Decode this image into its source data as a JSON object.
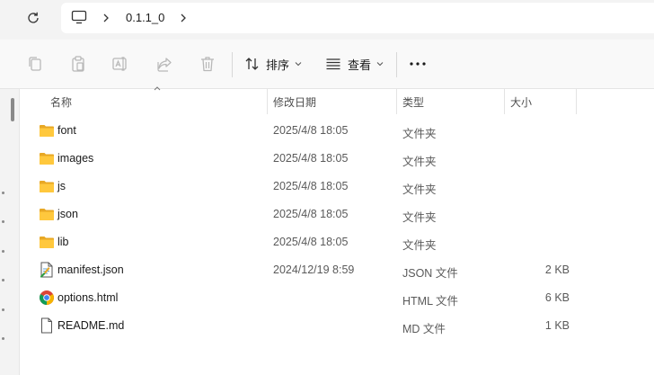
{
  "address_bar": {
    "root_icon": "computer-icon",
    "path_segments": [
      "0.1.1_0"
    ]
  },
  "toolbar": {
    "actions": [
      {
        "name": "copy",
        "icon": "copy-icon"
      },
      {
        "name": "paste",
        "icon": "paste-icon"
      },
      {
        "name": "rename",
        "icon": "rename-icon"
      },
      {
        "name": "share",
        "icon": "share-icon"
      },
      {
        "name": "delete",
        "icon": "trash-icon"
      }
    ],
    "sort_label": "排序",
    "view_label": "查看",
    "more_icon": "more-icon"
  },
  "columns": {
    "name": "名称",
    "date_modified": "修改日期",
    "type": "类型",
    "size": "大小"
  },
  "files": [
    {
      "name": "font",
      "date": "2025/4/8 18:05",
      "type": "文件夹",
      "size": "",
      "icon": "folder-icon"
    },
    {
      "name": "images",
      "date": "2025/4/8 18:05",
      "type": "文件夹",
      "size": "",
      "icon": "folder-icon"
    },
    {
      "name": "js",
      "date": "2025/4/8 18:05",
      "type": "文件夹",
      "size": "",
      "icon": "folder-icon"
    },
    {
      "name": "json",
      "date": "2025/4/8 18:05",
      "type": "文件夹",
      "size": "",
      "icon": "folder-icon"
    },
    {
      "name": "lib",
      "date": "2025/4/8 18:05",
      "type": "文件夹",
      "size": "",
      "icon": "folder-icon"
    },
    {
      "name": "manifest.json",
      "date": "2024/12/19 8:59",
      "type": "JSON 文件",
      "size": "2 KB",
      "icon": "json-file-icon"
    },
    {
      "name": "options.html",
      "date": "",
      "type": "HTML 文件",
      "size": "6 KB",
      "icon": "chrome-icon"
    },
    {
      "name": "README.md",
      "date": "",
      "type": "MD 文件",
      "size": "1 KB",
      "icon": "document-icon"
    }
  ],
  "colors": {
    "folder": "#ffc83d",
    "folder_dark": "#e8a825",
    "background": "#ffffff",
    "toolbar_bg": "#f9f9f9",
    "icon_gray": "#b8b8b8"
  }
}
